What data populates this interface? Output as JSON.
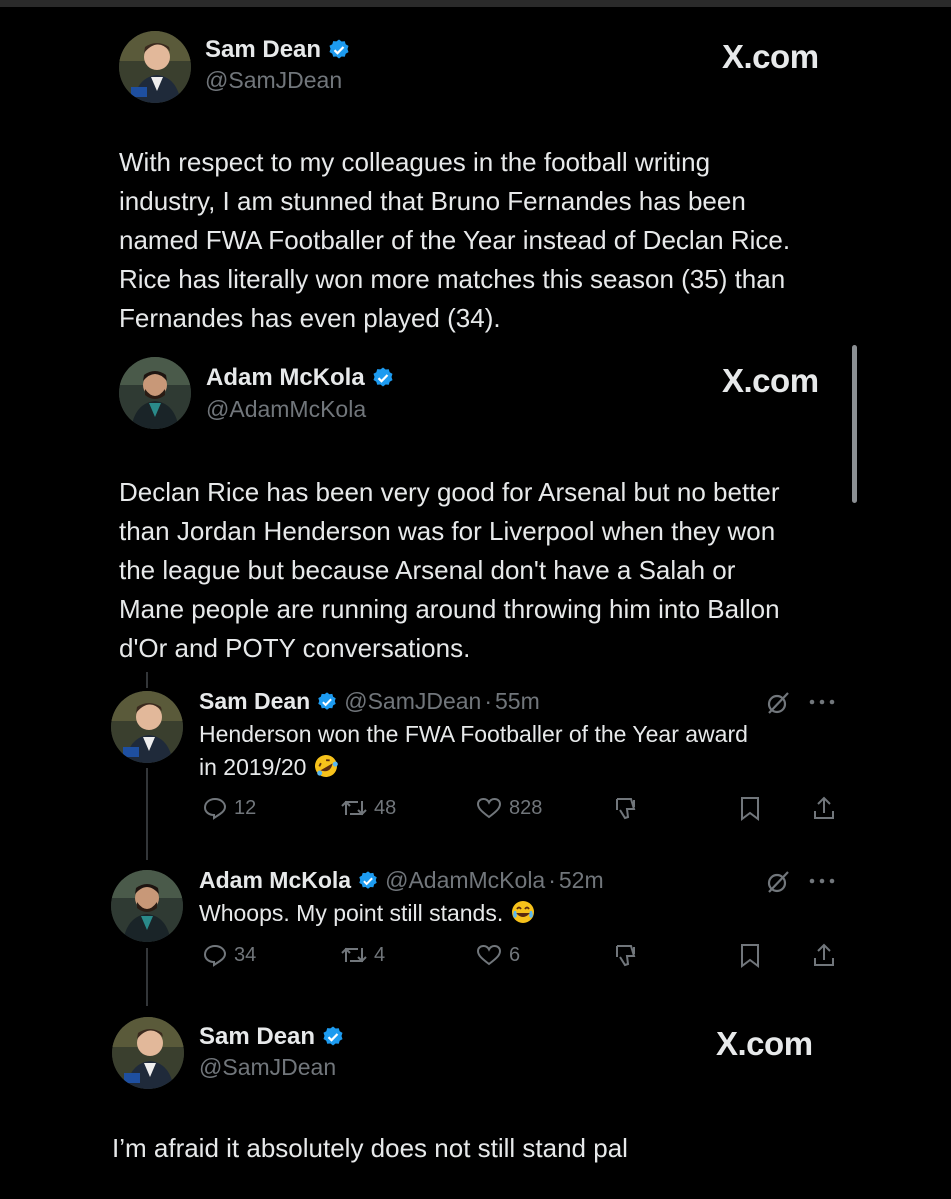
{
  "colors": {
    "background": "#000000",
    "text": "#e7e9ea",
    "muted": "#71767b",
    "verified": "#1d9bf0",
    "emoji": "#f7c21b"
  },
  "watermark": "X.com",
  "tweet1": {
    "name": "Sam Dean",
    "handle": "@SamJDean",
    "lines": [
      "With respect to my colleagues in the football writing",
      "industry, I am stunned that Bruno Fernandes has been",
      "named FWA Footballer of the Year instead of Declan Rice.",
      "Rice has literally won more matches this season (35) than",
      "Fernandes has even played (34)."
    ]
  },
  "quoted": {
    "name": "Adam McKola",
    "handle": "@AdamMcKola",
    "lines": [
      "Declan Rice has been very good for Arsenal but no better",
      "than Jordan Henderson was for Liverpool when they won",
      "the league but because Arsenal don't have a Salah or",
      "Mane people are running around throwing him into Ballon",
      "d'Or and POTY conversations."
    ]
  },
  "reply1": {
    "name": "Sam Dean",
    "handle": "@SamJDean",
    "dot": "·",
    "time": "55m",
    "lines": [
      "Henderson won the FWA Footballer of the Year award",
      "in 2019/20"
    ],
    "emoji": "rolling-on-floor-laughing-emoji",
    "stats": {
      "replies": "12",
      "reposts": "48",
      "likes": "828"
    },
    "icons": [
      "reply-icon",
      "repost-icon",
      "like-icon",
      "dislike-icon",
      "bookmark-icon",
      "share-icon",
      "grok-icon",
      "more-icon"
    ]
  },
  "reply2": {
    "name": "Adam McKola",
    "handle": "@AdamMcKola",
    "dot": "·",
    "time": "52m",
    "text": "Whoops. My point still stands.",
    "emoji": "tears-of-joy-emoji",
    "stats": {
      "replies": "34",
      "reposts": "4",
      "likes": "6"
    }
  },
  "tweet3": {
    "name": "Sam Dean",
    "handle": "@SamJDean",
    "text": "I’m afraid it absolutely does not still stand pal"
  }
}
